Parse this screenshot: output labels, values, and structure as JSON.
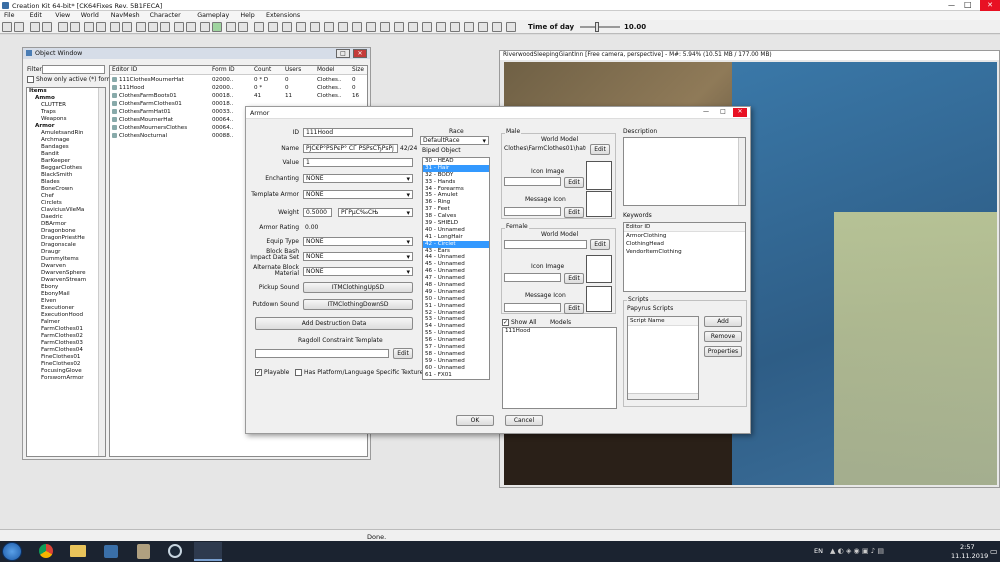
{
  "app": {
    "title": "Creation Kit 64-bit* [CK64Fixes Rev. 5B1FECA]"
  },
  "menubar": [
    "File",
    "Edit",
    "View",
    "World",
    "NavMesh",
    "Character",
    "Gameplay",
    "Help",
    "Extensions"
  ],
  "timeofday": {
    "label": "Time of day",
    "value": "10.00",
    "level": 0.42
  },
  "object_window": {
    "title": "Object Window",
    "filter_label": "Filter",
    "show_active": "Show only active (*) forms",
    "tree": [
      {
        "t": "Items",
        "lvl": 0
      },
      {
        "t": "Ammo",
        "lvl": 1
      },
      {
        "t": "CLUTTER",
        "lvl": 2
      },
      {
        "t": "Traps",
        "lvl": 2
      },
      {
        "t": "Weapons",
        "lvl": 2
      },
      {
        "t": "Armor",
        "lvl": 1
      },
      {
        "t": "AmuletsandRin",
        "lvl": 2
      },
      {
        "t": "Archmage",
        "lvl": 2
      },
      {
        "t": "Bandages",
        "lvl": 2
      },
      {
        "t": "Bandit",
        "lvl": 2
      },
      {
        "t": "BarKeeper",
        "lvl": 2
      },
      {
        "t": "BeggarClothes",
        "lvl": 2
      },
      {
        "t": "BlackSmith",
        "lvl": 2
      },
      {
        "t": "Blades",
        "lvl": 2
      },
      {
        "t": "BoneCrown",
        "lvl": 2
      },
      {
        "t": "Chef",
        "lvl": 2
      },
      {
        "t": "Circlets",
        "lvl": 2
      },
      {
        "t": "ClaviciusVileMa",
        "lvl": 2
      },
      {
        "t": "Daedric",
        "lvl": 2
      },
      {
        "t": "DBArmor",
        "lvl": 2
      },
      {
        "t": "Dragonbone",
        "lvl": 2
      },
      {
        "t": "DragonPriestHe",
        "lvl": 2
      },
      {
        "t": "Dragonscale",
        "lvl": 2
      },
      {
        "t": "Draugr",
        "lvl": 2
      },
      {
        "t": "DummyItems",
        "lvl": 2
      },
      {
        "t": "Dwarven",
        "lvl": 2
      },
      {
        "t": "DwarvenSphere",
        "lvl": 2
      },
      {
        "t": "DwarvenStream",
        "lvl": 2
      },
      {
        "t": "Ebony",
        "lvl": 2
      },
      {
        "t": "EbonyMail",
        "lvl": 2
      },
      {
        "t": "Elven",
        "lvl": 2
      },
      {
        "t": "Executioner",
        "lvl": 2
      },
      {
        "t": "ExecutionHood",
        "lvl": 2
      },
      {
        "t": "Falmer",
        "lvl": 2
      },
      {
        "t": "FarmClothes01",
        "lvl": 2
      },
      {
        "t": "FarmClothes02",
        "lvl": 2
      },
      {
        "t": "FarmClothes03",
        "lvl": 2
      },
      {
        "t": "FarmClothes04",
        "lvl": 2
      },
      {
        "t": "FineClothes01",
        "lvl": 2
      },
      {
        "t": "FineClothes02",
        "lvl": 2
      },
      {
        "t": "FocusingGlove",
        "lvl": 2
      },
      {
        "t": "ForswornArmor",
        "lvl": 2
      }
    ],
    "columns": [
      "Editor ID",
      "Form ID",
      "Count",
      "Users",
      "Model",
      "Size"
    ],
    "rows": [
      [
        "111ClothesMournerHat",
        "02000..",
        "0 * D",
        "0",
        "Clothes..",
        "0"
      ],
      [
        "111Hood",
        "02000..",
        "0 *",
        "0",
        "Clothes..",
        "0"
      ],
      [
        "ClothesFarmBoots01",
        "00018..",
        "41",
        "11",
        "Clothes..",
        "16"
      ],
      [
        "ClothesFarmClothes01",
        "00018..",
        "",
        "",
        "",
        ""
      ],
      [
        "ClothesFarmHat01",
        "00033..",
        "",
        "",
        "",
        ""
      ],
      [
        "ClothesMournerHat",
        "00064..",
        "",
        "",
        "",
        ""
      ],
      [
        "ClothesMournersClothes",
        "00064..",
        "",
        "",
        "",
        ""
      ],
      [
        "ClothesNocturnal",
        "00088..",
        "",
        "",
        "",
        ""
      ]
    ]
  },
  "render_window": {
    "title": "RiverwoodSleepingGiantInn [Free camera, perspective] - M#: 5.94% (10.51 MB / 177.00 MB)"
  },
  "armor": {
    "title": "Armor",
    "id_label": "ID",
    "id_value": "111Hood",
    "name_label": "Name",
    "name_value": "РЈС€Р°РЅРєР° СЃ РЅРѕСЂРѕРј",
    "name_count": "42/24",
    "value_label": "Value",
    "value_value": "1",
    "enchanting_label": "Enchanting",
    "enchanting_value": "NONE",
    "template_label": "Template Armor",
    "template_value": "NONE",
    "weight_label": "Weight",
    "weight_value": "0.5000",
    "weight_type": "РЃРµС‰СЊ",
    "armor_rating_label": "Armor Rating",
    "armor_rating_value": "0.00",
    "equip_label": "Equip Type",
    "equip_value": "NONE",
    "block_label": "Block Bash Impact Data Set",
    "block_value": "NONE",
    "altblock_label": "Alternate Block Material",
    "altblock_value": "NONE",
    "pickup_label": "Pickup Sound",
    "pickup_value": "ITMClothingUpSD",
    "putdown_label": "Putdown Sound",
    "putdown_value": "ITMClothingDownSD",
    "add_destruction": "Add Destruction Data",
    "ragdoll_label": "Ragdoll Constraint Template",
    "edit": "Edit",
    "playable": "Playable",
    "platform": "Has Platform/Language Specific Textures",
    "race_label": "Race",
    "race_value": "DefaultRace",
    "biped_label": "Biped Object",
    "biped": [
      "30 - HEAD",
      "31 - Hair",
      "32 - BODY",
      "33 - Hands",
      "34 - Forearms",
      "35 - Amulet",
      "36 - Ring",
      "37 - Feet",
      "38 - Calves",
      "39 - SHIELD",
      "40 - Unnamed",
      "41 - LongHair",
      "42 - Circlet",
      "43 - Ears",
      "44 - Unnamed",
      "45 - Unnamed",
      "46 - Unnamed",
      "47 - Unnamed",
      "48 - Unnamed",
      "49 - Unnamed",
      "50 - Unnamed",
      "51 - Unnamed",
      "52 - Unnamed",
      "53 - Unnamed",
      "54 - Unnamed",
      "55 - Unnamed",
      "56 - Unnamed",
      "57 - Unnamed",
      "58 - Unnamed",
      "59 - Unnamed",
      "60 - Unnamed",
      "61 - FX01"
    ],
    "biped_selected": [
      1,
      12
    ],
    "male_label": "Male",
    "world_model_label": "World Model",
    "male_world_model": "Clothes\\FarmClothes01\\hatGO n",
    "icon_image_label": "Icon Image",
    "message_icon_label": "Message Icon",
    "female_label": "Female",
    "show_all": "Show All",
    "models_label": "Models",
    "models": [
      "111Hood"
    ],
    "description_label": "Description",
    "keywords_label": "Keywords",
    "keywords_header": "Editor ID",
    "keywords": [
      "ArmorClothing",
      "ClothingHead",
      "VendorItemClothing"
    ],
    "scripts_label": "Scripts",
    "papyrus_label": "Papyrus Scripts",
    "script_name": "Script Name",
    "add": "Add",
    "remove": "Remove",
    "properties": "Properties",
    "ok": "OK",
    "cancel": "Cancel"
  },
  "status": {
    "text": "Done."
  },
  "taskbar": {
    "lang": "EN",
    "time": "2:57",
    "date": "11.11.2019"
  },
  "colors": {
    "accent": "#3399ff",
    "titlebar": "#d6dde8",
    "taskbar": "#1b2330"
  }
}
